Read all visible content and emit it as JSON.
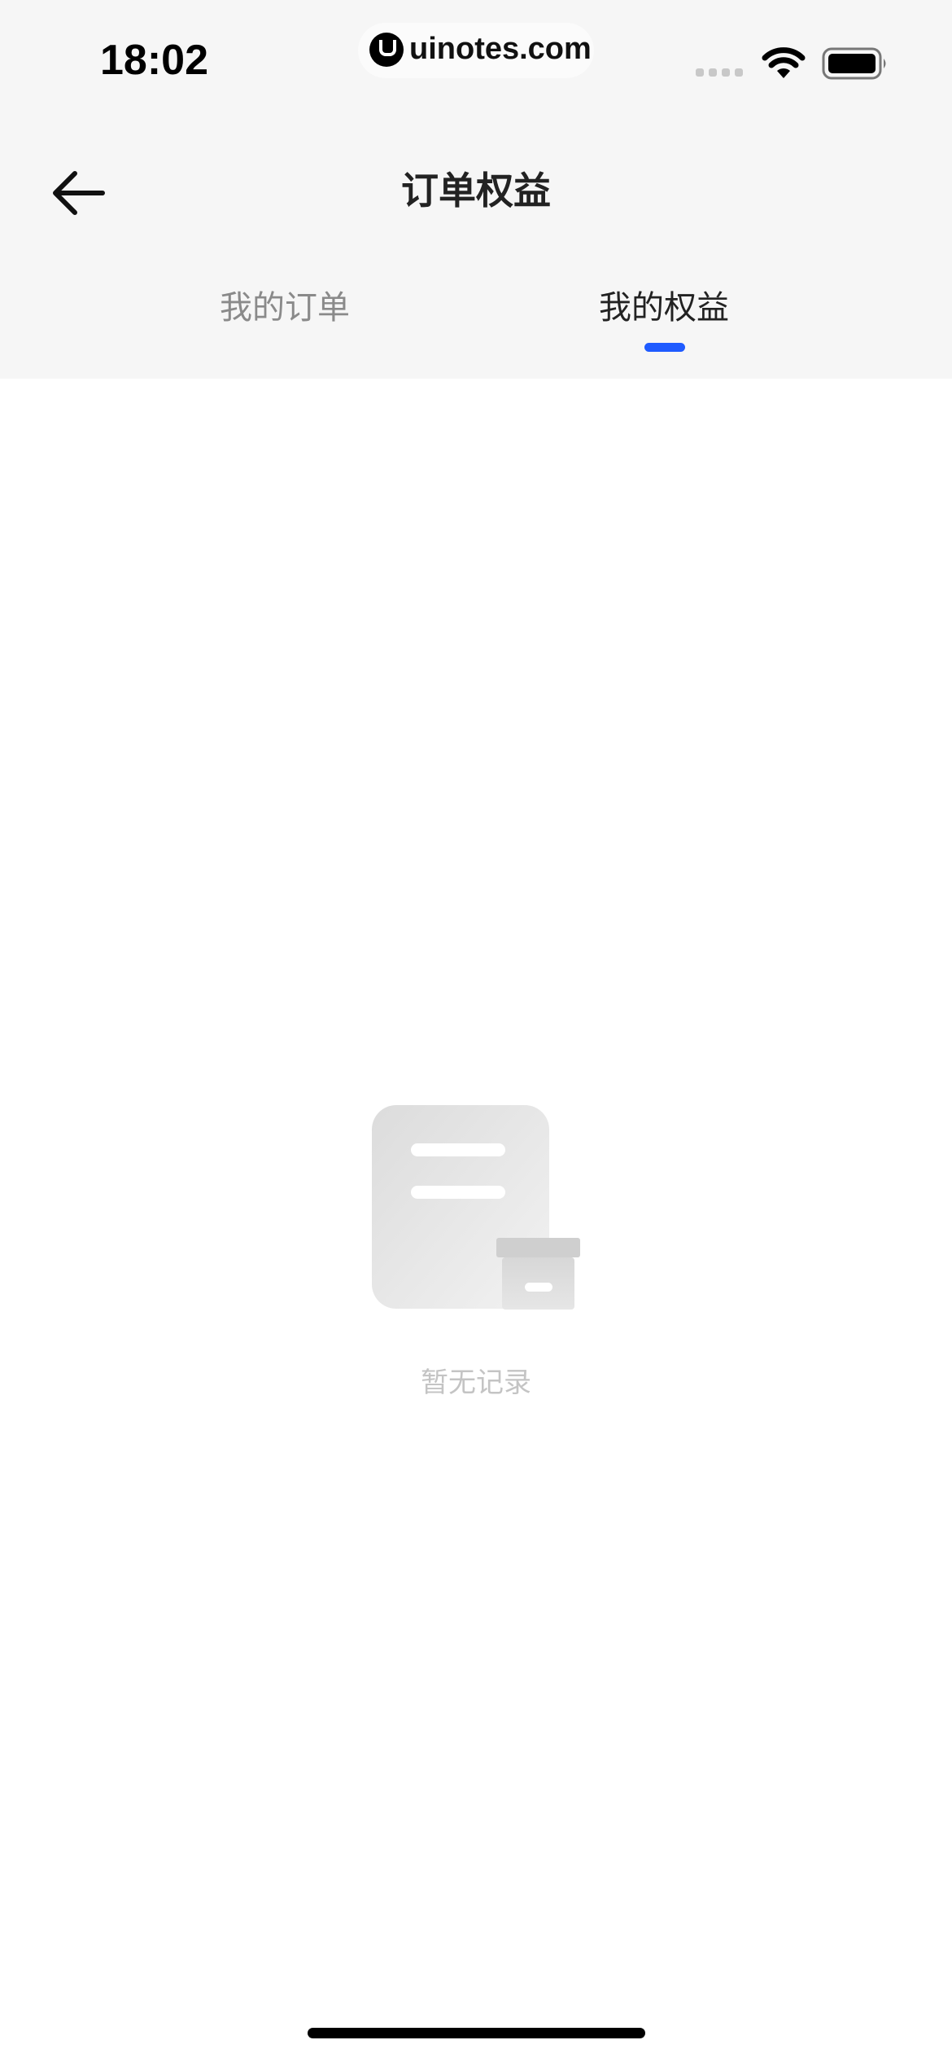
{
  "status_bar": {
    "time": "18:02",
    "watermark": "uinotes.com",
    "icons": [
      "signal-icon",
      "wifi-icon",
      "battery-icon"
    ]
  },
  "header": {
    "title": "订单权益",
    "back_icon": "arrow-left-icon"
  },
  "tabs": [
    {
      "label": "我的订单",
      "active": false
    },
    {
      "label": "我的权益",
      "active": true
    }
  ],
  "empty_state": {
    "icon": "empty-document-box-icon",
    "message": "暂无记录"
  },
  "colors": {
    "accent": "#1f5bff",
    "header_background": "#f6f6f6",
    "inactive_tab": "#8a8a8a",
    "empty_text": "#c4c4c4"
  }
}
